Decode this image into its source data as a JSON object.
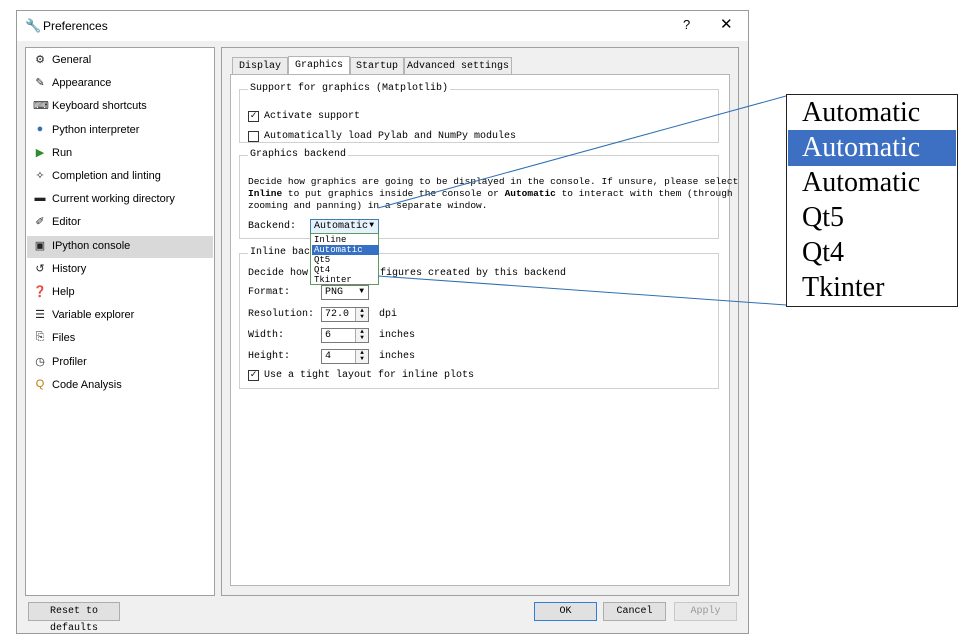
{
  "window": {
    "title": "Preferences",
    "help": "?",
    "close": "✕"
  },
  "sidebar": {
    "items": [
      {
        "label": "General",
        "icon": "gears-icon",
        "glyph": "⚙"
      },
      {
        "label": "Appearance",
        "icon": "paint-icon",
        "glyph": "✎"
      },
      {
        "label": "Keyboard shortcuts",
        "icon": "keyboard-icon",
        "glyph": "⌨"
      },
      {
        "label": "Python interpreter",
        "icon": "python-icon",
        "glyph": "●"
      },
      {
        "label": "Run",
        "icon": "run-icon",
        "glyph": "▶"
      },
      {
        "label": "Completion and linting",
        "icon": "completion-icon",
        "glyph": "✧"
      },
      {
        "label": "Current working directory",
        "icon": "folder-icon",
        "glyph": "▬"
      },
      {
        "label": "Editor",
        "icon": "editor-icon",
        "glyph": "✐"
      },
      {
        "label": "IPython console",
        "icon": "console-icon",
        "glyph": "▣"
      },
      {
        "label": "History",
        "icon": "history-icon",
        "glyph": "↺"
      },
      {
        "label": "Help",
        "icon": "help-icon",
        "glyph": "❓"
      },
      {
        "label": "Variable explorer",
        "icon": "table-icon",
        "glyph": "☰"
      },
      {
        "label": "Files",
        "icon": "files-icon",
        "glyph": "⎘"
      },
      {
        "label": "Profiler",
        "icon": "profiler-icon",
        "glyph": "◷"
      },
      {
        "label": "Code Analysis",
        "icon": "analysis-icon",
        "glyph": "Q"
      }
    ]
  },
  "tabs": [
    "Display",
    "Graphics",
    "Startup",
    "Advanced settings"
  ],
  "support": {
    "title": "Support for graphics (Matplotlib)",
    "activate": "Activate support",
    "autoload": "Automatically load Pylab and NumPy modules"
  },
  "backend": {
    "title": "Graphics backend",
    "desc1_a": "Decide how graphics are going to be displayed in the console. If unsure, please select",
    "desc2_bold1": "Inline",
    "desc2_a": " to put graphics inside the console or ",
    "desc2_bold2": "Automatic",
    "desc2_b": " to interact with them (through",
    "desc3": "zooming and panning) in a separate window.",
    "label": "Backend:",
    "value": "Automatic",
    "options": [
      "Inline",
      "Automatic",
      "Qt5",
      "Qt4",
      "Tkinter"
    ]
  },
  "inline": {
    "title": "Inline backend",
    "desc_a": "Decide how t",
    "desc_b": "figures created by this backend",
    "format_label": "Format:",
    "format_value": "PNG",
    "resolution_label": "Resolution:",
    "resolution_value": "72.0",
    "resolution_unit": "dpi",
    "width_label": "Width:",
    "width_value": "6",
    "width_unit": "inches",
    "height_label": "Height:",
    "height_value": "4",
    "height_unit": "inches",
    "tight": "Use a tight layout for inline plots"
  },
  "buttons": {
    "reset": "Reset to defaults",
    "ok": "OK",
    "cancel": "Cancel",
    "apply": "Apply"
  },
  "callout": {
    "items": [
      "Automatic",
      "Automatic",
      "Automatic",
      "Qt5",
      "Qt4",
      "Tkinter"
    ]
  },
  "colors": {
    "selection": "#3670c4",
    "callout_selection": "#3d70c2"
  }
}
